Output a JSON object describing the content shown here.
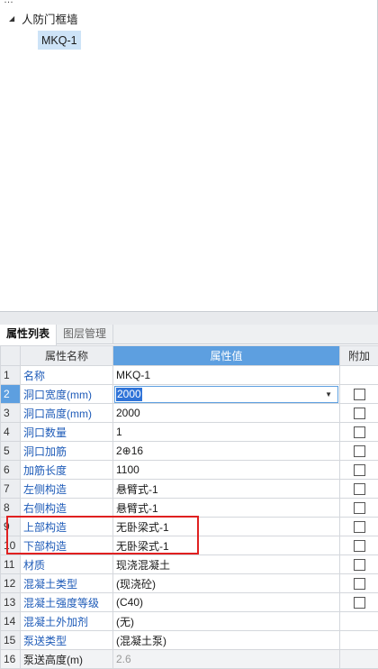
{
  "tree": {
    "header_fragment": "…",
    "root_label": "人防门框墙",
    "child_label": "MKQ-1"
  },
  "tabs": [
    {
      "label": "属性列表",
      "active": true
    },
    {
      "label": "图层管理",
      "active": false
    }
  ],
  "grid": {
    "headers": {
      "num": "",
      "name": "属性名称",
      "value": "属性值",
      "add": "附加"
    },
    "rows": [
      {
        "num": "1",
        "name": "名称",
        "value": "MKQ-1",
        "checkbox": false,
        "link": true
      },
      {
        "num": "2",
        "name": "洞口宽度(mm)",
        "value": "2000",
        "checkbox": true,
        "link": true,
        "editing": true
      },
      {
        "num": "3",
        "name": "洞口高度(mm)",
        "value": "2000",
        "checkbox": true,
        "link": true
      },
      {
        "num": "4",
        "name": "洞口数量",
        "value": "1",
        "checkbox": true,
        "link": true
      },
      {
        "num": "5",
        "name": "洞口加筋",
        "value": "2⊕16",
        "checkbox": true,
        "link": true
      },
      {
        "num": "6",
        "name": "加筋长度",
        "value": "1100",
        "checkbox": true,
        "link": true
      },
      {
        "num": "7",
        "name": "左侧构造",
        "value": "悬臂式-1",
        "checkbox": true,
        "link": true
      },
      {
        "num": "8",
        "name": "右侧构造",
        "value": "悬臂式-1",
        "checkbox": true,
        "link": true
      },
      {
        "num": "9",
        "name": "上部构造",
        "value": "无卧梁式-1",
        "checkbox": true,
        "link": true
      },
      {
        "num": "10",
        "name": "下部构造",
        "value": "无卧梁式-1",
        "checkbox": true,
        "link": true
      },
      {
        "num": "11",
        "name": "材质",
        "value": "现浇混凝土",
        "checkbox": true,
        "link": true
      },
      {
        "num": "12",
        "name": "混凝土类型",
        "value": "(现浇砼)",
        "checkbox": true,
        "link": true
      },
      {
        "num": "13",
        "name": "混凝土强度等级",
        "value": "(C40)",
        "checkbox": true,
        "link": true
      },
      {
        "num": "14",
        "name": "混凝土外加剂",
        "value": "(无)",
        "checkbox": false,
        "link": true
      },
      {
        "num": "15",
        "name": "泵送类型",
        "value": "(混凝土泵)",
        "checkbox": false,
        "link": true
      },
      {
        "num": "16",
        "name": "泵送高度(m)",
        "value": "2.6",
        "checkbox": false,
        "link": false,
        "muted": true
      }
    ]
  },
  "colors": {
    "accent": "#5d9fe0",
    "link": "#1e5bb8",
    "highlight_box": "#e02020",
    "tree_selected": "#cde3f7"
  }
}
